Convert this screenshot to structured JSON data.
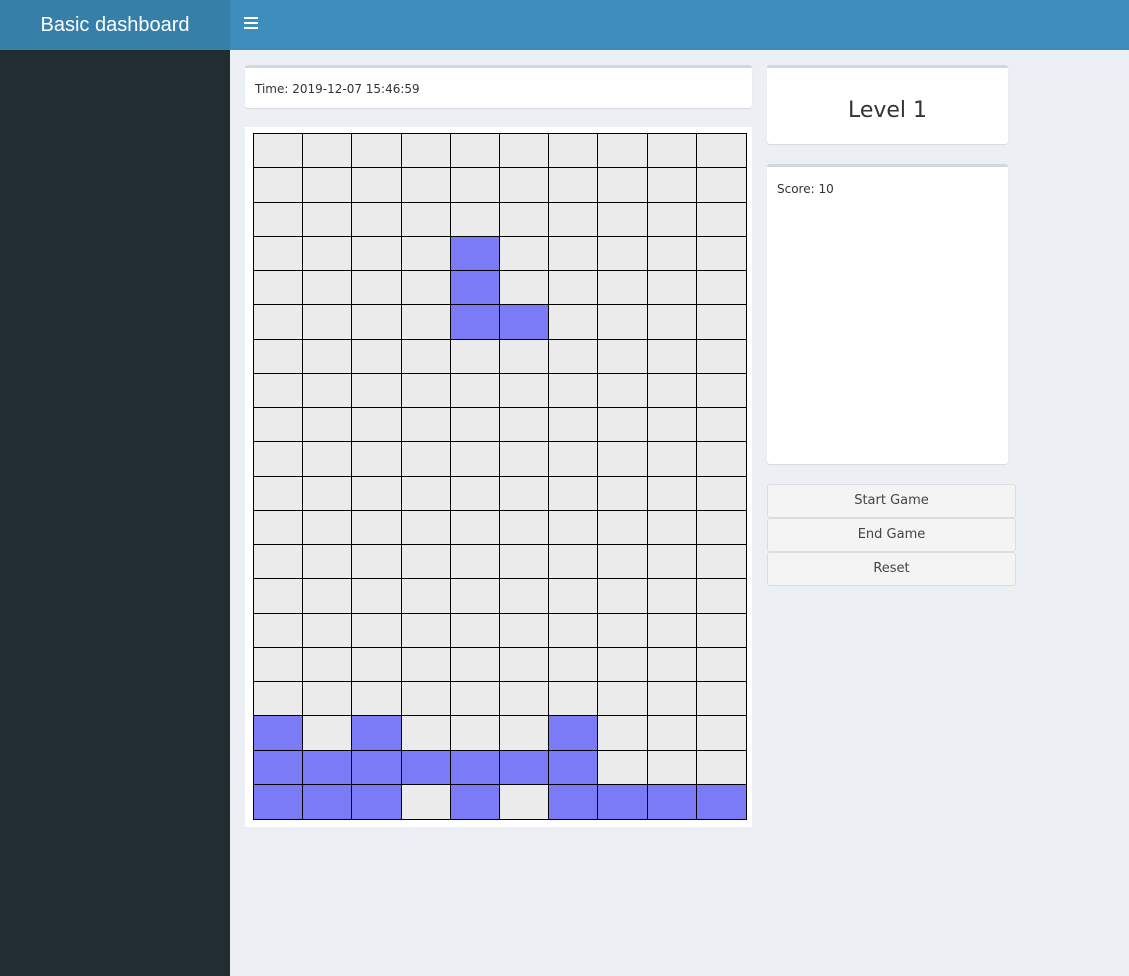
{
  "header": {
    "title": "Basic dashboard",
    "menu_icon": "hamburger-icon",
    "logo_bg": "#367fa9",
    "bar_bg": "#3c8dbc"
  },
  "sidebar": {
    "bg": "#222d32"
  },
  "time": {
    "text": "Time: 2019-12-07 15:46:59"
  },
  "level": {
    "text": "Level 1"
  },
  "score": {
    "text": "Score: 10"
  },
  "controls": {
    "start_label": "Start Game",
    "end_label": "End Game",
    "reset_label": "Reset"
  },
  "board": {
    "columns": 10,
    "rows": 20,
    "empty_color": "#ebebeb",
    "block_color": "#7b7bf7",
    "grid": [
      "0000000000",
      "0000000000",
      "0000000000",
      "0000100000",
      "0000100000",
      "0000110000",
      "0000000000",
      "0000000000",
      "0000000000",
      "0000000000",
      "0000000000",
      "0000000000",
      "0000000000",
      "0000000000",
      "0000000000",
      "0000000000",
      "0000000000",
      "1010001000",
      "1111111000",
      "1110101111"
    ]
  }
}
